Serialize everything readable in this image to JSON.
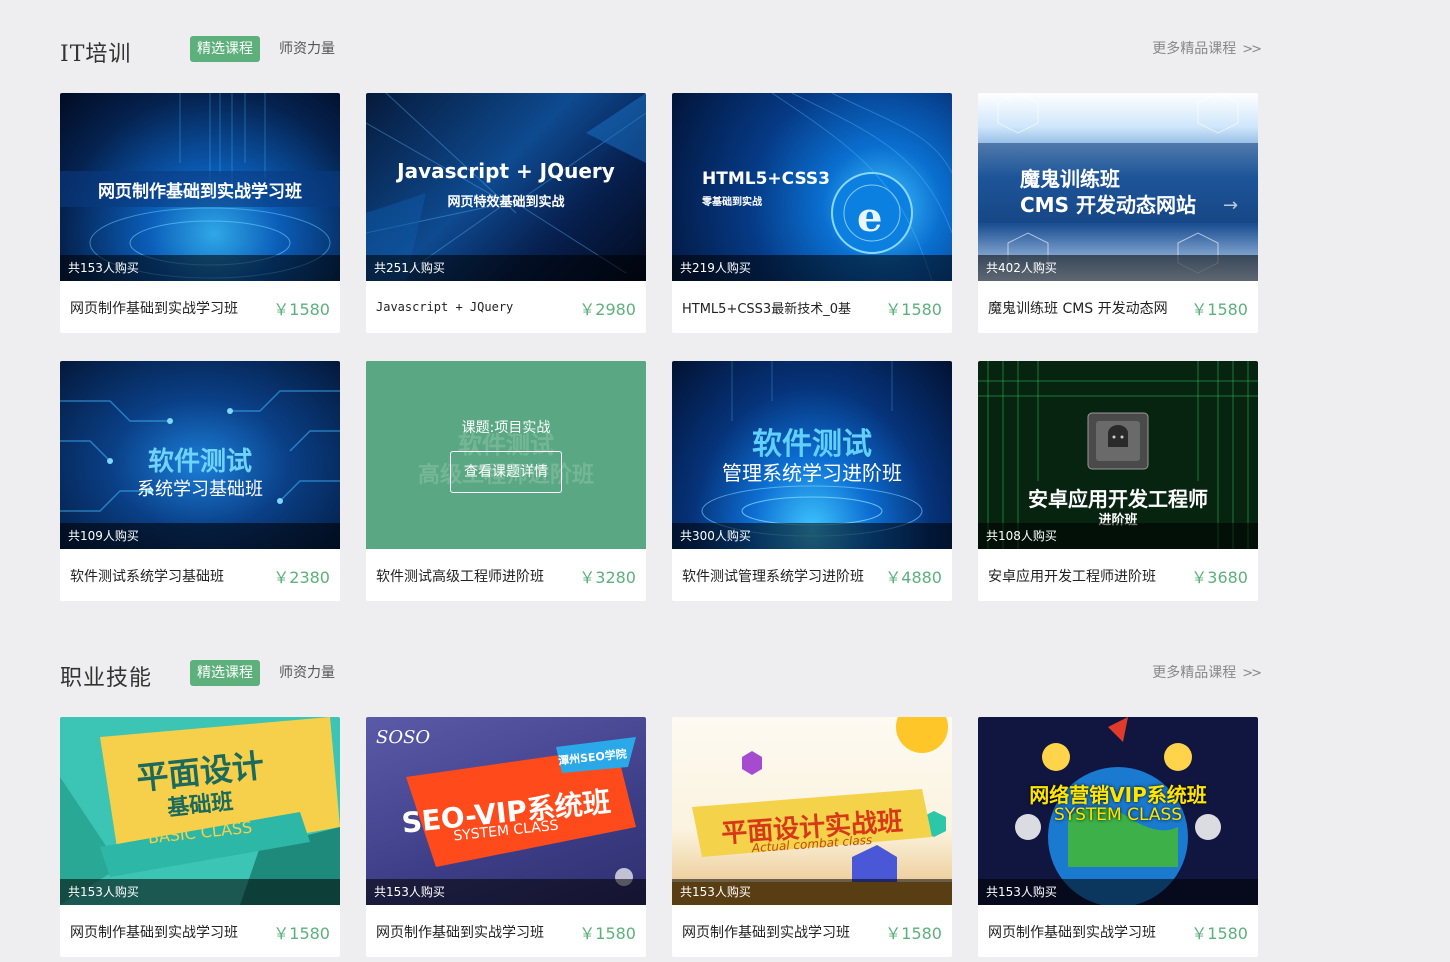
{
  "sections": [
    {
      "title": "IT培训",
      "tab_active": "精选课程",
      "tab_other": "师资力量",
      "more": "更多精品课程",
      "more_icon": ">>",
      "courses": [
        {
          "cover_line1": "网页制作基础到实战学习班",
          "cover_line2": "",
          "buyers": "共153人购买",
          "name": "网页制作基础到实战学习班",
          "price": "￥1580"
        },
        {
          "cover_line1": "Javascript + JQuery",
          "cover_line2": "网页特效基础到实战",
          "buyers": "共251人购买",
          "name": "Javascript + JQuery",
          "price": "￥2980"
        },
        {
          "cover_line1": "HTML5+CSS3",
          "cover_line2": "零基础到实战",
          "buyers": "共219人购买",
          "name": "HTML5+CSS3最新技术_0基",
          "price": "￥1580"
        },
        {
          "cover_line1": "魔鬼训练班",
          "cover_line2": "CMS 开发动态网站",
          "buyers": "共402人购买",
          "name": "魔鬼训练班 CMS 开发动态网",
          "price": "￥1580"
        },
        {
          "cover_line1": "软件测试",
          "cover_line2": "系统学习基础班",
          "buyers": "共109人购买",
          "name": "软件测试系统学习基础班",
          "price": "￥2380"
        },
        {
          "cover_line1": "软件测试",
          "cover_line2": "高级工程师进阶班",
          "buyers": "",
          "name": "软件测试高级工程师进阶班",
          "price": "￥3280",
          "hover_topic": "课题:项目实战",
          "hover_button": "查看课题详情"
        },
        {
          "cover_line1": "软件测试",
          "cover_line2": "管理系统学习进阶班",
          "buyers": "共300人购买",
          "name": "软件测试管理系统学习进阶班",
          "price": "￥4880"
        },
        {
          "cover_line1": "安卓应用开发工程师",
          "cover_line2": "进阶班",
          "buyers": "共108人购买",
          "name": "安卓应用开发工程师进阶班",
          "price": "￥3680"
        }
      ]
    },
    {
      "title": "职业技能",
      "tab_active": "精选课程",
      "tab_other": "师资力量",
      "more": "更多精品课程",
      "more_icon": ">>",
      "courses": [
        {
          "cover_line1": "平面设计",
          "cover_line2": "基础班",
          "cover_line3": "BASIC CLASS",
          "buyers": "共153人购买",
          "name": "网页制作基础到实战学习班",
          "price": "￥1580"
        },
        {
          "cover_line1": "SEO-VIP系统班",
          "cover_line2": "SYSTEM CLASS",
          "cover_tag": "潭州SEO学院",
          "cover_logo": "SOSO",
          "buyers": "共153人购买",
          "name": "网页制作基础到实战学习班",
          "price": "￥1580"
        },
        {
          "cover_line1": "平面设计实战班",
          "cover_line2": "Actual combat class",
          "buyers": "共153人购买",
          "name": "网页制作基础到实战学习班",
          "price": "￥1580"
        },
        {
          "cover_line1": "网络营销VIP系统班",
          "cover_line2": "SYSTEM CLASS",
          "buyers": "共153人购买",
          "name": "网页制作基础到实战学习班",
          "price": "￥1580"
        }
      ]
    }
  ],
  "colors": {
    "accent": "#5db07c",
    "background": "#eeeef0"
  }
}
